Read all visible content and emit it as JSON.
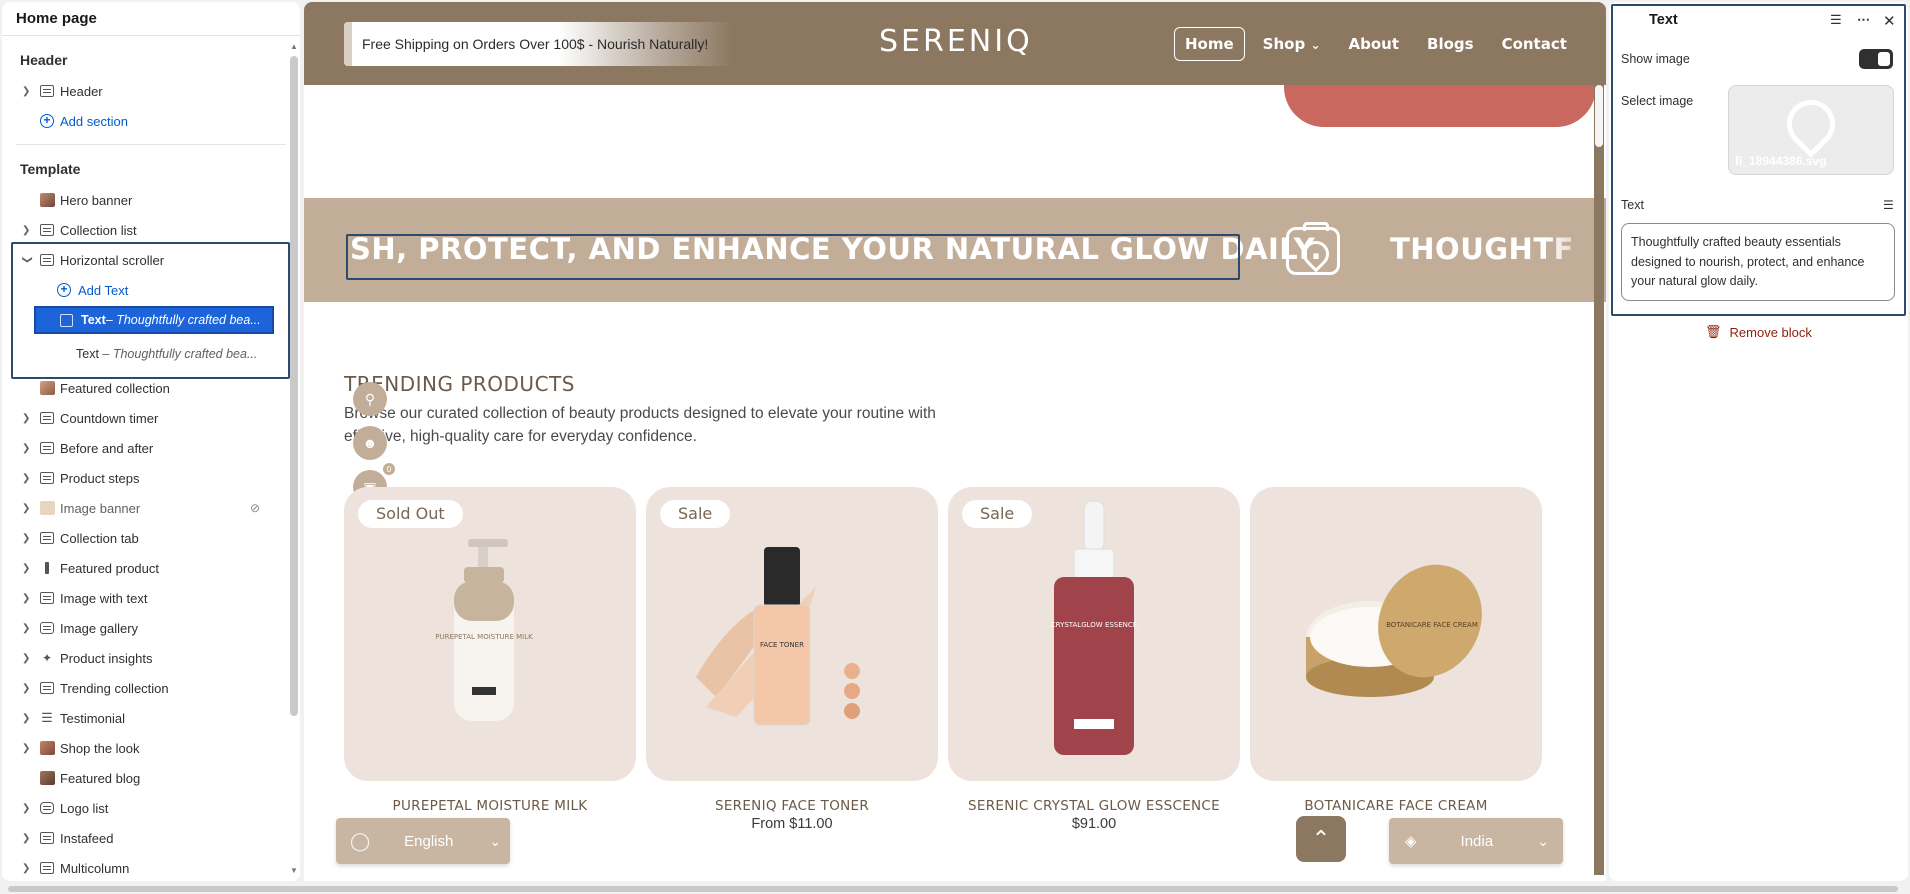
{
  "sidebar": {
    "title": "Home page",
    "header_group": "Header",
    "header_items": [
      {
        "label": "Header"
      },
      {
        "label": "Add section"
      }
    ],
    "template_group": "Template",
    "items": [
      {
        "label": "Hero banner"
      },
      {
        "label": "Collection list"
      },
      {
        "label": "Horizontal scroller"
      },
      {
        "label": "Add Text"
      },
      {
        "label": "Text",
        "sub": " – Thoughtfully crafted bea..."
      },
      {
        "label": "Text",
        "sub": " – Thoughtfully crafted bea..."
      },
      {
        "label": "Featured collection"
      },
      {
        "label": "Countdown timer"
      },
      {
        "label": "Before and after"
      },
      {
        "label": "Product steps"
      },
      {
        "label": "Image banner"
      },
      {
        "label": "Collection tab"
      },
      {
        "label": "Featured product"
      },
      {
        "label": "Image with text"
      },
      {
        "label": "Image gallery"
      },
      {
        "label": "Product insights"
      },
      {
        "label": "Trending collection"
      },
      {
        "label": "Testimonial"
      },
      {
        "label": "Shop the look"
      },
      {
        "label": "Featured blog"
      },
      {
        "label": "Logo list"
      },
      {
        "label": "Instafeed"
      },
      {
        "label": "Multicolumn"
      }
    ]
  },
  "preview": {
    "promo": "Free Shipping on Orders Over 100$ - Nourish Naturally!",
    "brand": "SERENIQ",
    "nav": [
      "Home",
      "Shop",
      "About",
      "Blogs",
      "Contact"
    ],
    "nav_shop_chevron": "⌄",
    "scroller_text": "SH, PROTECT, AND ENHANCE YOUR NATURAL GLOW DAILY.",
    "scroller_text_next": "THOUGHTF",
    "trending_title": "TRENDING PRODUCTS",
    "trending_desc": "Browse our curated collection of beauty products designed to elevate your routine with effective, high-quality care for everyday confidence.",
    "cart_count": "0",
    "products": [
      {
        "name": "PUREPETAL MOISTURE MILK",
        "price": "",
        "badge": "Sold Out",
        "label": "PUREPETAL MOISTURE MILK"
      },
      {
        "name": "SERENIQ FACE TONER",
        "price": "From $11.00",
        "badge": "Sale",
        "label": "FACE TONER"
      },
      {
        "name": "SERENIC CRYSTAL GLOW ESSCENCE",
        "price": "$91.00",
        "badge": "Sale",
        "label": "CRYSTALGLOW ESSENCE"
      },
      {
        "name": "BOTANICARE FACE CREAM",
        "price": "",
        "badge": "",
        "label": "BOTANICARE FACE CREAM"
      }
    ],
    "language": "English",
    "country": "India"
  },
  "panel": {
    "title": "Text",
    "show_image_label": "Show image",
    "select_image_label": "Select image",
    "image_filename": "fi_18944386.svg",
    "text_label": "Text",
    "text_value": "Thoughtfully crafted beauty essentials designed to nourish, protect, and enhance your natural glow daily.",
    "remove_label": "Remove block"
  },
  "colors": {
    "brand": "#8c7761",
    "accent": "#c2ae98",
    "selection": "#1d63d9"
  }
}
